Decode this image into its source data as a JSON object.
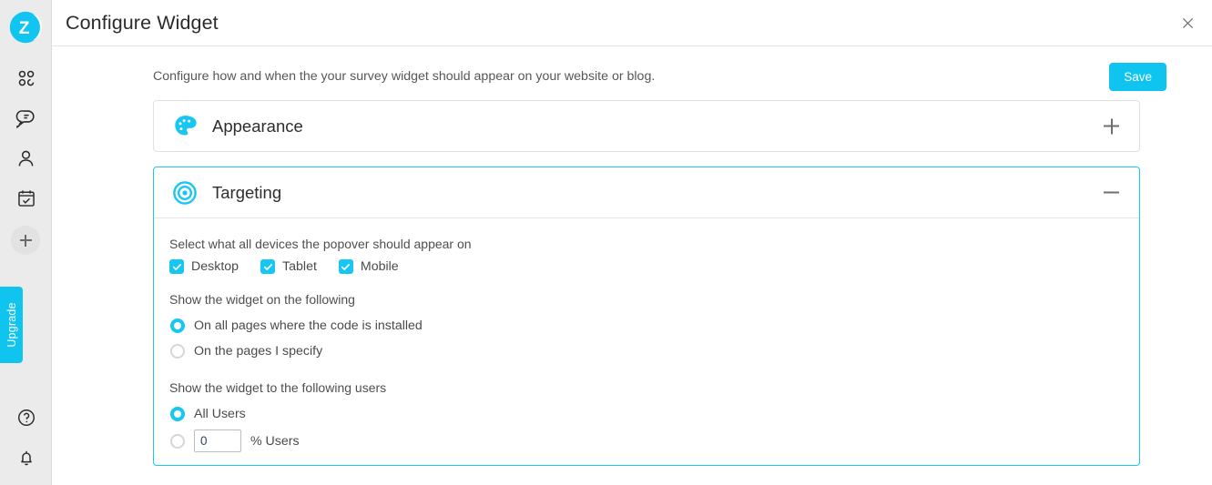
{
  "sidebar": {
    "logo": {
      "icon": "zoho-z-logo",
      "letter": "Z"
    },
    "nav_items": [
      {
        "icon": "dashboard-grid-icon",
        "label": "Dashboard"
      },
      {
        "icon": "chat-bubbles-icon",
        "label": "Conversations"
      },
      {
        "icon": "user-icon",
        "label": "Contacts"
      },
      {
        "icon": "calendar-check-icon",
        "label": "Tasks"
      }
    ],
    "add_button": {
      "icon": "plus-icon",
      "label": "Add"
    },
    "upgrade": {
      "label": "Upgrade"
    },
    "bottom_items": [
      {
        "icon": "help-circle-icon",
        "label": "Help"
      },
      {
        "icon": "bell-icon",
        "label": "Notifications"
      }
    ]
  },
  "header": {
    "title": "Configure Widget",
    "close": {
      "icon": "close-icon",
      "label": "Close"
    }
  },
  "main": {
    "description": "Configure how and when the your survey widget should appear on your website or blog.",
    "save_label": "Save"
  },
  "cards": {
    "appearance": {
      "title": "Appearance",
      "icon": "palette-icon",
      "expanded": false,
      "toggle_icon": "plus-icon"
    },
    "targeting": {
      "title": "Targeting",
      "icon": "target-icon",
      "expanded": true,
      "toggle_icon": "minus-icon",
      "devices": {
        "label": "Select what all devices the popover should appear on",
        "options": [
          {
            "label": "Desktop",
            "checked": true
          },
          {
            "label": "Tablet",
            "checked": true
          },
          {
            "label": "Mobile",
            "checked": true
          }
        ]
      },
      "pages": {
        "label": "Show the widget on the following",
        "options": [
          {
            "label": "On all pages where the code is installed",
            "selected": true
          },
          {
            "label": "On the pages I specify",
            "selected": false
          }
        ]
      },
      "users": {
        "label": "Show the widget to the following users",
        "options": [
          {
            "label": "All Users",
            "selected": true
          },
          {
            "label": "",
            "selected": false
          }
        ],
        "percent_value": "0",
        "percent_label": "% Users"
      }
    }
  },
  "colors": {
    "accent": "#17c6f2",
    "save_button": "#10c4f0",
    "sidebar_bg": "#ebebeb",
    "text": "#4a4a4a"
  }
}
